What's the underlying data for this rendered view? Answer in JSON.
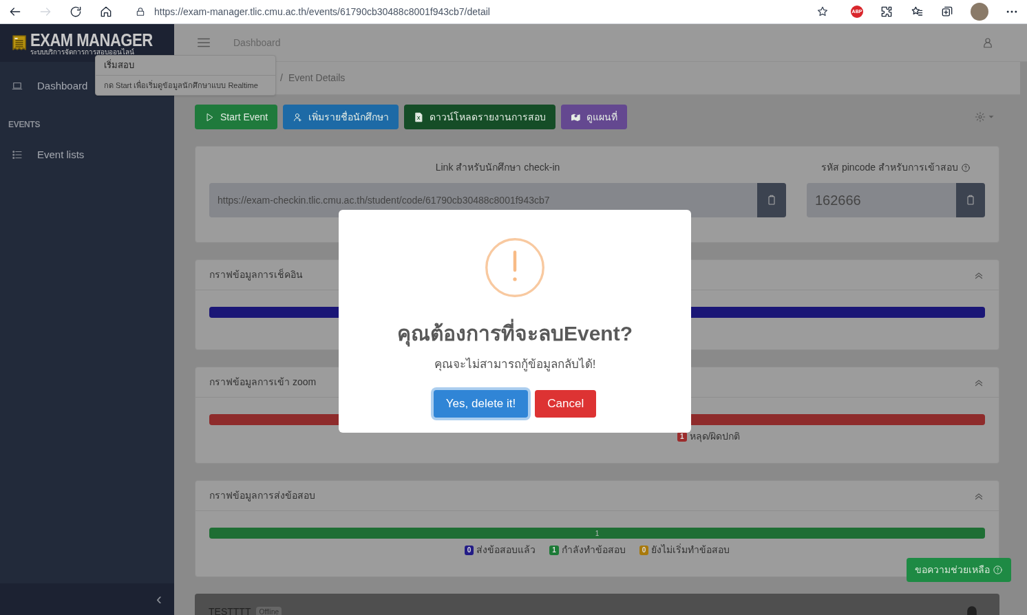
{
  "browser": {
    "url": "https://exam-manager.tlic.cmu.ac.th/events/61790cb30488c8001f943cb7/detail",
    "adblock": "ABP"
  },
  "sidebar": {
    "brand": {
      "title": "EXAM MANAGER",
      "subtitle": "ระบบบริการจัดการการสอบออนไลน์"
    },
    "items": [
      {
        "kind": "link",
        "label": "Dashboard"
      },
      {
        "kind": "section",
        "label": "EVENTS"
      },
      {
        "kind": "link",
        "label": "Event lists"
      }
    ],
    "collapse": "‹"
  },
  "topbar": {
    "title": "Dashboard",
    "breadcrumb_separator": "/",
    "breadcrumb": "Event Details"
  },
  "tooltip": {
    "title": "เริ่มสอบ",
    "body": "กด Start เพื่อเริ่มดูข้อมูลนักศึกษาแบบ Realtime"
  },
  "actions": [
    {
      "label": "Start Event",
      "color": "#1f7a3c"
    },
    {
      "label": "เพิ่มรายชื่อนักศึกษา",
      "color": "#1d6aa6"
    },
    {
      "label": "ดาวน์โหลดรายงานการสอบ",
      "color": "#154d27"
    },
    {
      "label": "ดูแผนที่",
      "color": "#644890"
    }
  ],
  "links": {
    "link_label": "Link สำหรับนักศึกษา check-in",
    "link_value": "https://exam-checkin.tlic.cmu.ac.th/student/code/61790cb30488c8001f943cb7",
    "pin_label": "รหัส pincode สำหรับการเข้าสอบ",
    "pin_value": "162666"
  },
  "charts": [
    {
      "title": "กราฟข้อมูลการเช็คอิน",
      "bar": {
        "level": 1,
        "color": "#1a1676"
      }
    },
    {
      "title": "กราฟข้อมูลการเข้า zoom",
      "bar": {
        "level": 1,
        "color": "#8e2b2b"
      },
      "legend": [
        {
          "count": "1",
          "label": "หลุด/ผิดปกติ",
          "color": "#9b2c2c"
        }
      ]
    },
    {
      "title": "กราฟข้อมูลการส่งข้อสอบ",
      "bar": {
        "level": 1,
        "color": "#1e6e34",
        "label": "1"
      },
      "legend": [
        {
          "count": "0",
          "label": "ส่งข้อสอบแล้ว",
          "color": "#231c86"
        },
        {
          "count": "1",
          "label": "กำลังทำข้อสอบ",
          "color": "#1c7a36"
        },
        {
          "count": "0",
          "label": "ยังไม่เริ่มทำข้อสอบ",
          "color": "#a8790b"
        }
      ]
    }
  ],
  "device": {
    "name": "TESTTTT",
    "status": "Offline"
  },
  "help_button": "ขอความช่วยเหลือ",
  "modal": {
    "title": "คุณต้องการที่จะลบEvent?",
    "text": "คุณจะไม่สามารถกู้ข้อมูลกลับได้!",
    "confirm": "Yes, delete it!",
    "cancel": "Cancel"
  }
}
